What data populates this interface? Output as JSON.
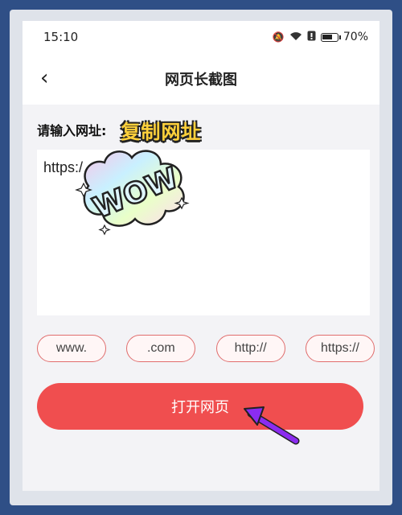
{
  "status_bar": {
    "time": "15:10",
    "battery": "70%",
    "battery_level": 0.7
  },
  "nav": {
    "back_glyph": "‹",
    "title": "网页长截图"
  },
  "prompt": {
    "label": "请输入网址:",
    "annotation": "复制网址"
  },
  "url_input": {
    "value": "https:/"
  },
  "sticker": {
    "text": "WOW"
  },
  "chips": [
    {
      "label": "www."
    },
    {
      "label": ".com"
    },
    {
      "label": "http://"
    },
    {
      "label": "https://"
    }
  ],
  "primary_button": {
    "label": "打开网页"
  },
  "colors": {
    "accent": "#f04e4f",
    "chip_border": "#e06d6d",
    "annotation": "#ffd13b",
    "arrow": "#8b2cf0",
    "frame": "#2f4f86"
  }
}
